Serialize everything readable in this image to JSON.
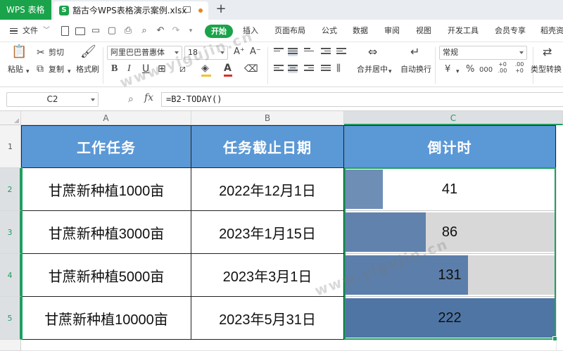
{
  "titlebar": {
    "app_tab": "WPS 表格",
    "doc_tab": "豁古今WPS表格演示案例.xlsx",
    "doc_icon": "S",
    "new_tab": "+"
  },
  "menubar": {
    "file": "文件",
    "start": "开始",
    "items": [
      "插入",
      "页面布局",
      "公式",
      "数据",
      "审阅",
      "视图",
      "开发工具",
      "会员专享",
      "稻壳资"
    ]
  },
  "ribbon": {
    "paste": "粘贴",
    "cut": "剪切",
    "copy": "复制",
    "format_painter": "格式刷",
    "font_name": "阿里巴巴普惠体",
    "font_size": "18",
    "merge_center": "合并居中",
    "wrap_text": "自动换行",
    "number_format": "常规",
    "type_convert": "类型转换",
    "currency_symbol": "¥",
    "percent_symbol": "%",
    "thousands_symbol": "000",
    "dec_increase": "+0 .00",
    "dec_decrease": ".00 +0"
  },
  "formula_bar": {
    "cell_ref": "C2",
    "fx": "fx",
    "formula": "=B2-TODAY()"
  },
  "grid": {
    "columns": [
      "A",
      "B",
      "C"
    ],
    "rows": [
      "1",
      "2",
      "3",
      "4",
      "5"
    ],
    "header": [
      "工作任务",
      "任务截止日期",
      "倒计时"
    ],
    "data": [
      {
        "task": "甘蔗新种植1000亩",
        "deadline": "2022年12月1日",
        "countdown": "41"
      },
      {
        "task": "甘蔗新种植3000亩",
        "deadline": "2023年1月15日",
        "countdown": "86"
      },
      {
        "task": "甘蔗新种植5000亩",
        "deadline": "2023年3月1日",
        "countdown": "131"
      },
      {
        "task": "甘蔗新种植10000亩",
        "deadline": "2023年5月31日",
        "countdown": "222"
      }
    ],
    "bar_max": 222,
    "bar_color": "#4f75a5",
    "header_color": "#5b98d6",
    "selection_color": "#1f9e62"
  },
  "watermark": "www.yigujin.cn"
}
